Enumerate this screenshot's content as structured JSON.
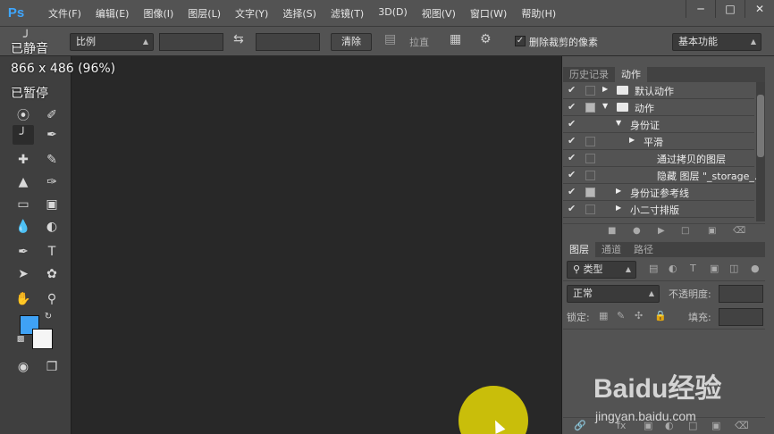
{
  "app": {
    "logo": "Ps",
    "menu": [
      "文件(F)",
      "编辑(E)",
      "图像(I)",
      "图层(L)",
      "文字(Y)",
      "选择(S)",
      "滤镜(T)",
      "3D(D)",
      "视图(V)",
      "窗口(W)",
      "帮助(H)"
    ],
    "window_controls": [
      "minimize-icon",
      "restore-icon",
      "close-icon"
    ]
  },
  "options_bar": {
    "ratio_select": "比例",
    "clear_button": "清除",
    "straighten_label": "拉直",
    "delete_cropped_label": "删除裁剪的像素",
    "delete_cropped_checked": true,
    "workspace_select": "基本功能"
  },
  "overlay": {
    "line1": "已静音",
    "line2": "866 x 486 (96%)",
    "line3": "已暂停"
  },
  "tools": {
    "foreground_color": "#3fa2f5",
    "background_color": "#f5f5f5"
  },
  "actions_panel": {
    "tabs": [
      "历史记录",
      "动作"
    ],
    "active_tab": "动作",
    "rows": [
      {
        "checked": true,
        "box": "empty",
        "expand": "right",
        "folder": true,
        "label": "默认动作"
      },
      {
        "checked": true,
        "box": "filled",
        "expand": "down",
        "folder": true,
        "label": "动作"
      },
      {
        "checked": true,
        "box": "none",
        "expand": "down",
        "folder": false,
        "label": "身份证"
      },
      {
        "checked": true,
        "box": "empty",
        "expand": "right",
        "folder": false,
        "label": "平滑"
      },
      {
        "checked": true,
        "box": "empty",
        "expand": "none",
        "folder": false,
        "label": "通过拷贝的图层"
      },
      {
        "checked": true,
        "box": "empty",
        "expand": "none",
        "folder": false,
        "label": "隐藏 图层 \"_storage_..."
      },
      {
        "checked": true,
        "box": "filled",
        "expand": "right",
        "folder": false,
        "label": "身份证参考线"
      },
      {
        "checked": true,
        "box": "empty",
        "expand": "right",
        "folder": false,
        "label": "小二寸排版"
      }
    ]
  },
  "layers_panel": {
    "tabs": [
      "图层",
      "通道",
      "路径"
    ],
    "active_tab": "图层",
    "filter_select": "类型",
    "blend_mode": "正常",
    "opacity_label": "不透明度:",
    "lock_label": "锁定:",
    "fill_label": "填充:"
  },
  "watermark": {
    "brand": "Baidu经验",
    "url": "jingyan.baidu.com"
  }
}
